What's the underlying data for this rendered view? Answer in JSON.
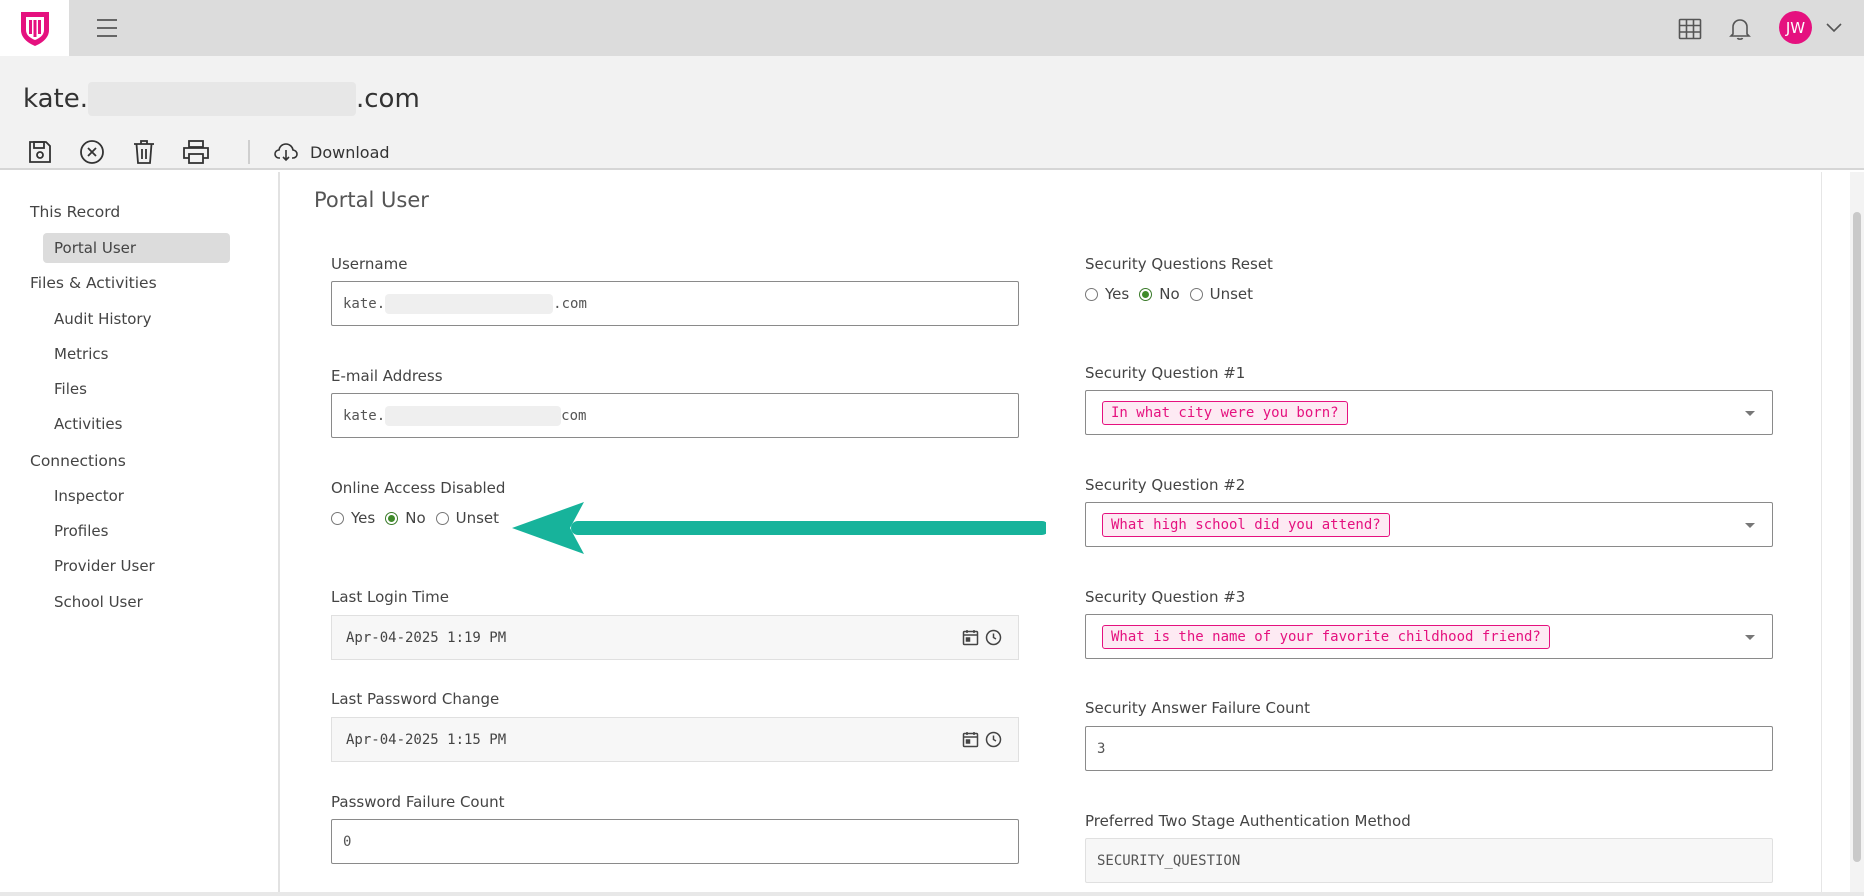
{
  "top_bar": {
    "icons": [
      "logo-shield",
      "hamburger-menu-icon",
      "grid-icon",
      "bell-icon"
    ],
    "avatar_initials": "JW",
    "brand_color": "#e5117f"
  },
  "record": {
    "title_prefix": "kate.",
    "title_suffix": ".com"
  },
  "toolbar": {
    "icons": [
      "save-icon",
      "close-circle-icon",
      "trash-icon",
      "print-icon"
    ],
    "download_label": "Download"
  },
  "sidebar": {
    "groups": [
      {
        "label": "This Record",
        "items": [
          "Portal User"
        ]
      },
      {
        "label": "Files & Activities",
        "items": [
          "Audit History",
          "Metrics",
          "Files",
          "Activities"
        ]
      },
      {
        "label": "Connections",
        "items": [
          "Inspector",
          "Profiles",
          "Provider User",
          "School User"
        ]
      }
    ],
    "active_item": "Portal User"
  },
  "main": {
    "section_title": "Portal User",
    "username": {
      "label": "Username",
      "value_prefix": "kate.",
      "value_suffix": ".com"
    },
    "email": {
      "label": "E-mail Address",
      "value_prefix": "kate.",
      "value_suffix": "com"
    },
    "online_access_disabled": {
      "label": "Online Access Disabled",
      "options": [
        "Yes",
        "No",
        "Unset"
      ],
      "selected": "No"
    },
    "last_login_time": {
      "label": "Last Login Time",
      "value": "Apr-04-2025 1:19 PM"
    },
    "last_password_change": {
      "label": "Last Password Change",
      "value": "Apr-04-2025 1:15 PM"
    },
    "password_failure_count": {
      "label": "Password Failure Count",
      "value": "0"
    },
    "security_questions_reset": {
      "label": "Security Questions Reset",
      "options": [
        "Yes",
        "No",
        "Unset"
      ],
      "selected": "No"
    },
    "security_question_1": {
      "label": "Security Question #1",
      "value": "In what city were you born?"
    },
    "security_question_2": {
      "label": "Security Question #2",
      "value": "What high school did you attend?"
    },
    "security_question_3": {
      "label": "Security Question #3",
      "value": "What is the name of your favorite childhood friend?"
    },
    "security_answer_failure_count": {
      "label": "Security Answer Failure Count",
      "value": "3"
    },
    "preferred_two_stage_auth": {
      "label": "Preferred Two Stage Authentication Method",
      "value": "SECURITY_QUESTION"
    }
  },
  "colors": {
    "accent": "#e5117f",
    "radio_checked": "#3f8b2a",
    "arrow": "#17b39b"
  }
}
